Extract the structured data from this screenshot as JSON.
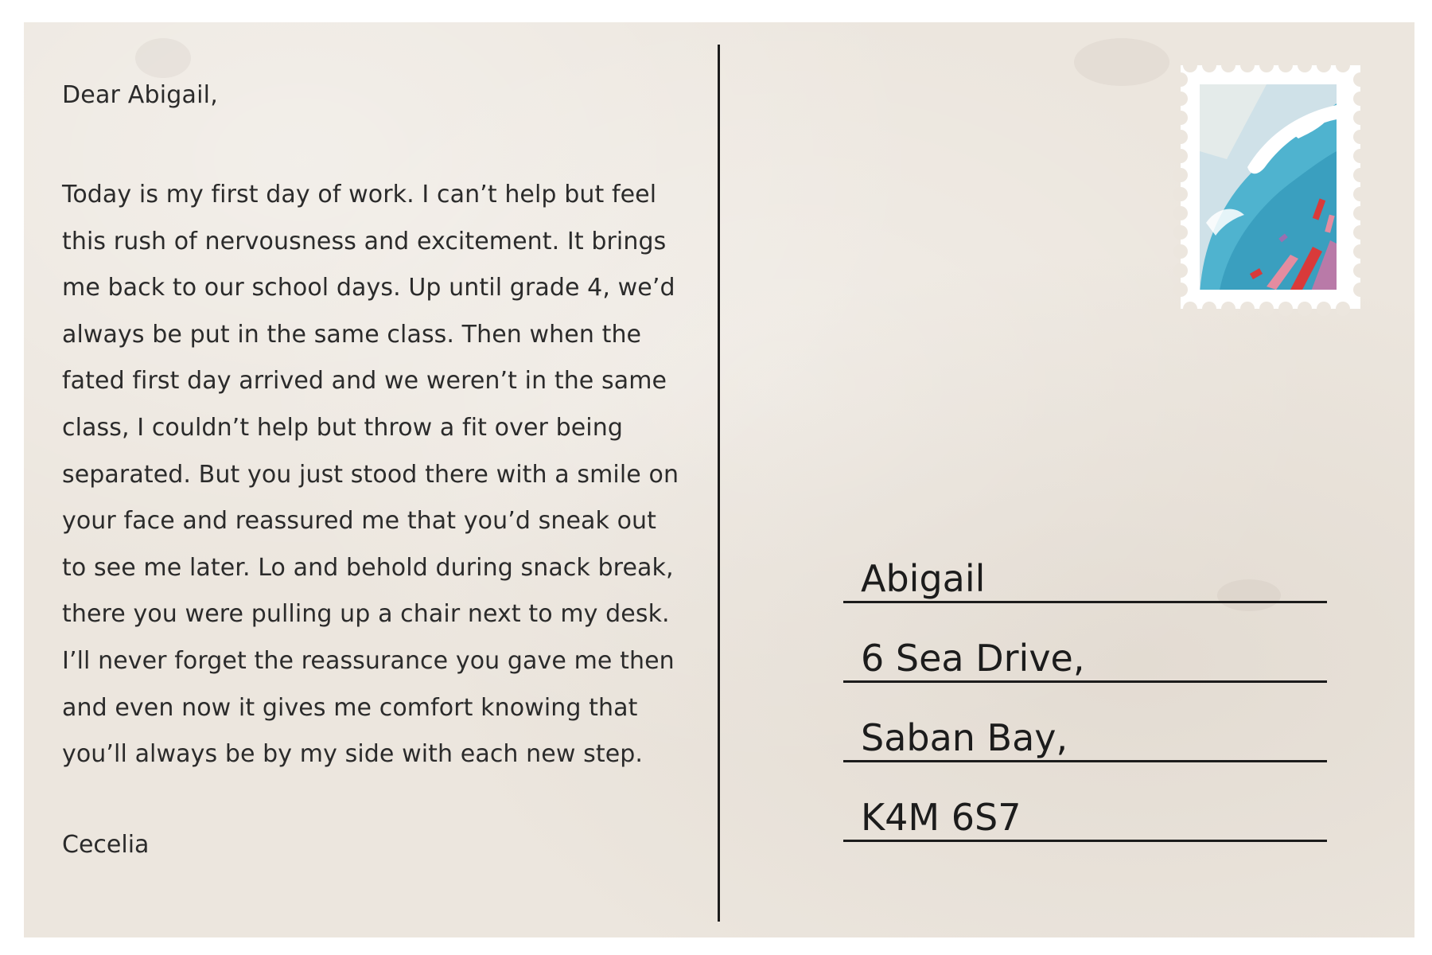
{
  "letter": {
    "greeting": "Dear Abigail,",
    "body": "Today is my first day of work. I can’t help but feel this rush of nervousness and excitement. It brings me back to our school days. Up until grade 4, we’d always be put in the same class. Then when the fated first day arrived and we weren’t in the same class, I couldn’t help but throw a fit over being separated. But you just stood there with a smile on your face and reassured me that you’d sneak out to see me later. Lo and behold during snack break, there you were pulling up a chair next to my desk. I’ll never forget the reassurance you gave me then and even now it gives me comfort knowing that you’ll always be by my side with each new step.",
    "signature": "Cecelia"
  },
  "address": {
    "lines": [
      "Abigail",
      "6 Sea Drive,",
      "Saban Bay,",
      "K4M 6S7"
    ]
  },
  "stamp": {
    "icon": "wave-stamp-icon",
    "colors": {
      "sky": "#cfe1e8",
      "wave": "#4fb3cf",
      "foam": "#ffffff",
      "accent_red": "#d93a3a",
      "accent_pink": "#e48ca0"
    }
  },
  "colors": {
    "paper": "#ece6de",
    "ink": "#2b2b2b",
    "rule": "#1c1c1c"
  }
}
